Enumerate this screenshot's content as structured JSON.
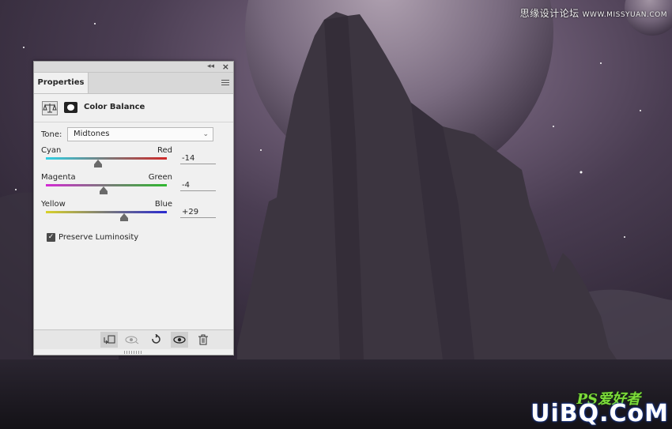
{
  "watermarks": {
    "top_cn": "思缘设计论坛",
    "top_site": "WWW.MISSYUAN.COM",
    "bottom_brand": "UiBQ.CoM",
    "bottom_ps": "PS爱好者"
  },
  "panel": {
    "tab_label": "Properties",
    "collapse_glyph": "◂◂",
    "close_glyph": "×",
    "adjustment_title": "Color Balance",
    "tone_label": "Tone:",
    "tone_value": "Midtones",
    "sliders": [
      {
        "left": "Cyan",
        "right": "Red",
        "value": "-14",
        "level": -14,
        "colors": [
          "#2fd1e6",
          "#d02828"
        ]
      },
      {
        "left": "Magenta",
        "right": "Green",
        "value": "-4",
        "level": -4,
        "colors": [
          "#d42ad4",
          "#2fb82f"
        ]
      },
      {
        "left": "Yellow",
        "right": "Blue",
        "value": "+29",
        "level": 29,
        "colors": [
          "#d9d22a",
          "#2a2ad0"
        ]
      }
    ],
    "preserve_label": "Preserve Luminosity",
    "preserve_checked": true,
    "check_glyph": "✓",
    "bottom_icons": [
      "clip-to-layer-icon",
      "view-previous-icon",
      "reset-icon",
      "visibility-icon",
      "delete-icon"
    ]
  },
  "colors": {
    "sky_top": "#2d2432",
    "sky_glow": "#8c7893",
    "rock": "#3c3540",
    "ground": "#1e1b22",
    "panel_bg": "#f0f0f0"
  }
}
